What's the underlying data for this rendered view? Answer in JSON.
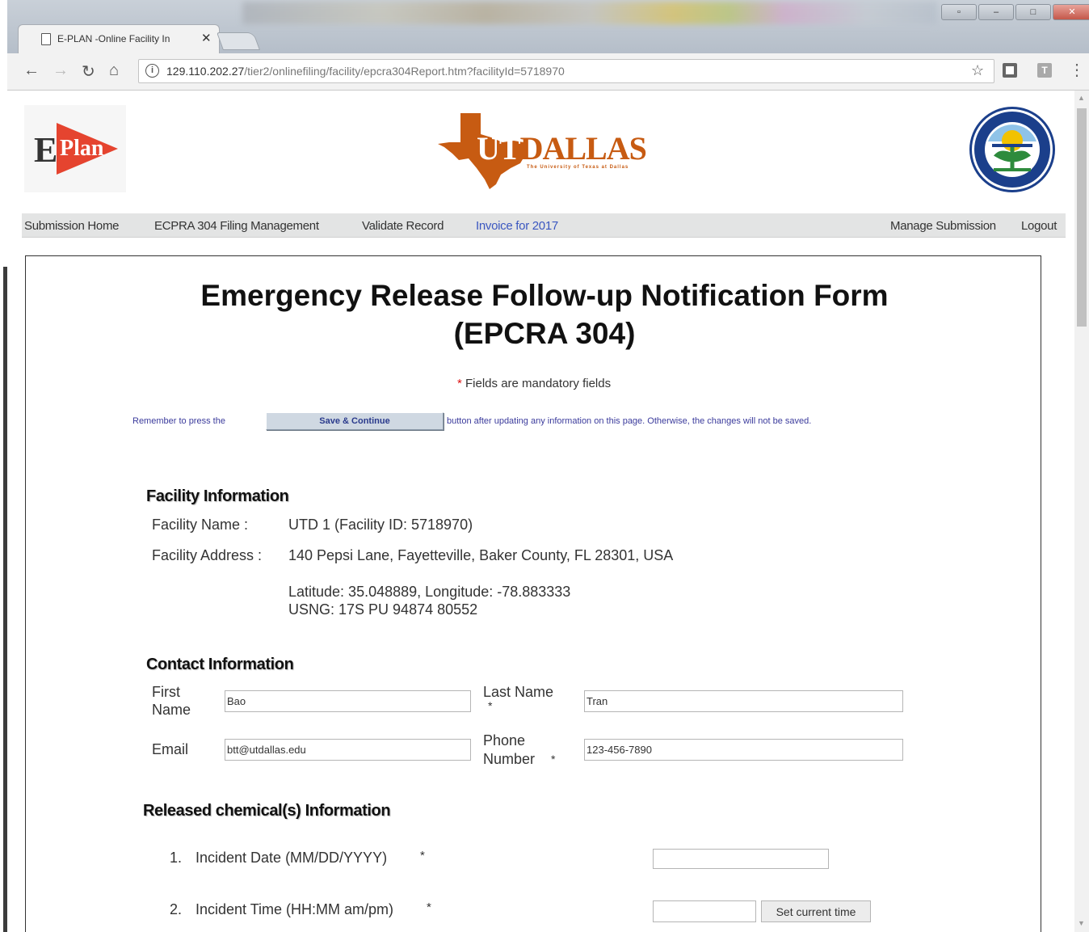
{
  "browser": {
    "tab_title": "E-PLAN -Online Facility In",
    "tab_close": "✕",
    "url_host": "129.110.202.27",
    "url_path": "/tier2/onlinefiling/facility/epcra304Report.htm?facilityId=5718970",
    "ext2_label": "T"
  },
  "header": {
    "eplan_e": "E",
    "eplan_plan": "Plan",
    "utd_text": "DALLAS",
    "utd_prefix": "UT",
    "utd_sub": "The University of Texas at Dallas"
  },
  "nav": {
    "items": [
      "Submission Home",
      "ECPRA 304 Filing Management",
      "Validate Record",
      "Invoice for 2017"
    ],
    "right_items": [
      "Manage Submission",
      "Logout"
    ]
  },
  "form": {
    "title_line1": "Emergency Release Follow-up Notification Form",
    "title_line2": "(EPCRA 304)",
    "mandatory_star": "*",
    "mandatory_text": " Fields are mandatory fields",
    "reminder_before": "Remember to press the",
    "save_button": "Save & Continue",
    "reminder_after": "button after updating any information on this page. Otherwise, the changes will not be saved."
  },
  "facility": {
    "heading": "Facility Information",
    "name_label": "Facility Name :",
    "name_value": "UTD 1 (Facility ID: 5718970)",
    "address_label": "Facility Address :",
    "address_value": "140 Pepsi Lane, Fayetteville, Baker County, FL 28301, USA",
    "latlong": "Latitude: 35.048889, Longitude: -78.883333",
    "usng": "USNG: 17S PU 94874 80552"
  },
  "contact": {
    "heading": "Contact Information",
    "first_label_1": "First",
    "first_label_2": "Name",
    "first_value": "Bao",
    "last_label": "Last Name",
    "last_value": "Tran",
    "email_label": "Email",
    "email_value": "btt@utdallas.edu",
    "phone_label_1": "Phone",
    "phone_label_2": "Number",
    "phone_value": "123-456-7890"
  },
  "released": {
    "heading": "Released chemical(s) Information",
    "q1_num": "1.",
    "q1_label": "Incident Date (MM/DD/YYYY)",
    "q1_value": "",
    "q2_num": "2.",
    "q2_label": "Incident Time (HH:MM am/pm)",
    "q2_value": "",
    "set_time_button": "Set current time"
  }
}
